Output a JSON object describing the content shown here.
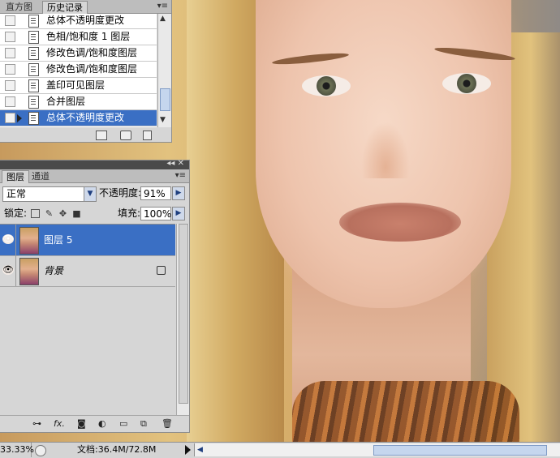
{
  "history_panel": {
    "tabs": [
      "直方图",
      "历史记录"
    ],
    "menu_icon": "panel-menu-icon",
    "items": [
      {
        "label": "总体不透明度更改",
        "selected": false
      },
      {
        "label": "色相/饱和度 1 图层",
        "selected": false
      },
      {
        "label": "修改色调/饱和度图层",
        "selected": false
      },
      {
        "label": "修改色调/饱和度图层",
        "selected": false
      },
      {
        "label": "盖印可见图层",
        "selected": false
      },
      {
        "label": "合并图层",
        "selected": false
      },
      {
        "label": "总体不透明度更改",
        "selected": true
      }
    ],
    "footer_icons": [
      "new-document-icon",
      "snapshot-icon",
      "trash-icon"
    ]
  },
  "layers_panel": {
    "tabs": [
      "图层",
      "通道"
    ],
    "collapse_glyph": "◂◂ ✕",
    "blend_mode": "正常",
    "opacity_label": "不透明度:",
    "opacity_value": "91%",
    "lock_label": "锁定:",
    "fill_label": "填充:",
    "fill_value": "100%",
    "layers": [
      {
        "name": "图层 5",
        "visible": true,
        "selected": true,
        "locked": false
      },
      {
        "name": "背景",
        "visible": true,
        "selected": false,
        "locked": true
      }
    ],
    "footer_icons": [
      "link-icon",
      "fx-icon",
      "mask-icon",
      "adjustment-icon",
      "folder-icon",
      "new-layer-icon",
      "trash-icon"
    ]
  },
  "status_bar": {
    "zoom": "33.33%",
    "doc_info": "文档:36.4M/72.8M"
  },
  "colors": {
    "selection": "#3a6fc4",
    "panel_bg": "#d6d6d6"
  }
}
